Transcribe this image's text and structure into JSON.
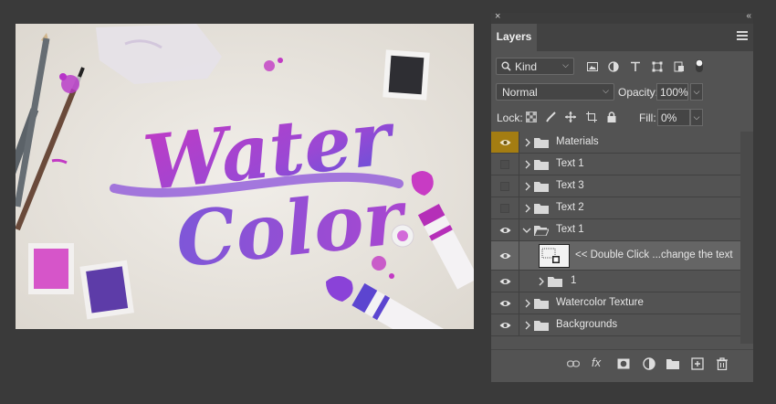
{
  "panel": {
    "close_glyph": "×",
    "collapse_glyph": "«",
    "tab_label": "Layers",
    "menu_icon": "panel-menu-icon"
  },
  "filter": {
    "kind_label": "Kind",
    "icons": [
      "image-filter-icon",
      "adjustment-filter-icon",
      "type-filter-icon",
      "shape-filter-icon",
      "smart-object-filter-icon",
      "filter-toggle-icon"
    ]
  },
  "blend": {
    "mode": "Normal",
    "opacity_label": "Opacity:",
    "opacity_value": "100%"
  },
  "lock": {
    "label": "Lock:",
    "icons": [
      "lock-transparent-icon",
      "lock-image-icon",
      "lock-position-icon",
      "lock-artboard-icon",
      "lock-all-icon"
    ],
    "fill_label": "Fill:",
    "fill_value": "0%"
  },
  "layers": [
    {
      "name": "Materials",
      "type": "group",
      "visible": true,
      "highlighted": true
    },
    {
      "name": "Text 1",
      "type": "group",
      "visible": false
    },
    {
      "name": "Text 3",
      "type": "group",
      "visible": false
    },
    {
      "name": "Text 2",
      "type": "group",
      "visible": false
    },
    {
      "name": "Text 1",
      "type": "group",
      "visible": true,
      "expanded": true
    },
    {
      "name": "<< Double Click ...change the text",
      "type": "smart-object",
      "visible": true,
      "selected": true
    },
    {
      "name": "1",
      "type": "group",
      "visible": true,
      "nested": true
    },
    {
      "name": "Watercolor Texture",
      "type": "group",
      "visible": true
    },
    {
      "name": "Backgrounds",
      "type": "group",
      "visible": true
    }
  ],
  "bottom_bar": {
    "icons": [
      "link-layers-icon",
      "fx-icon",
      "add-mask-icon",
      "adjustment-layer-icon",
      "new-group-icon",
      "new-layer-icon",
      "delete-layer-icon"
    ],
    "fx_label": "fx"
  },
  "canvas": {
    "artwork_text_line1": "Water",
    "artwork_text_line2": "Color"
  },
  "colors": {
    "app_bg": "#3a3a3a",
    "panel_bg": "#535353",
    "highlight_eye": "#a47d12",
    "selected_row": "#656565",
    "ink_purple": "#a63bc9",
    "ink_violet": "#6a4fd8"
  }
}
